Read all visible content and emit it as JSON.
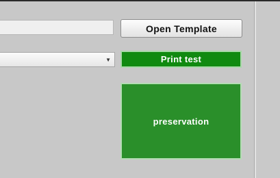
{
  "template": {
    "field_value": "",
    "open_label": "Open Template"
  },
  "printer": {
    "selected": "",
    "dropdown_icon": "chevron-down-icon"
  },
  "actions": {
    "print_test_label": "Print test",
    "preservation_label": "preservation"
  },
  "colors": {
    "print_button": "#108a10",
    "preservation_button": "#2a8f2a",
    "panel_background": "#c8c8c8"
  }
}
